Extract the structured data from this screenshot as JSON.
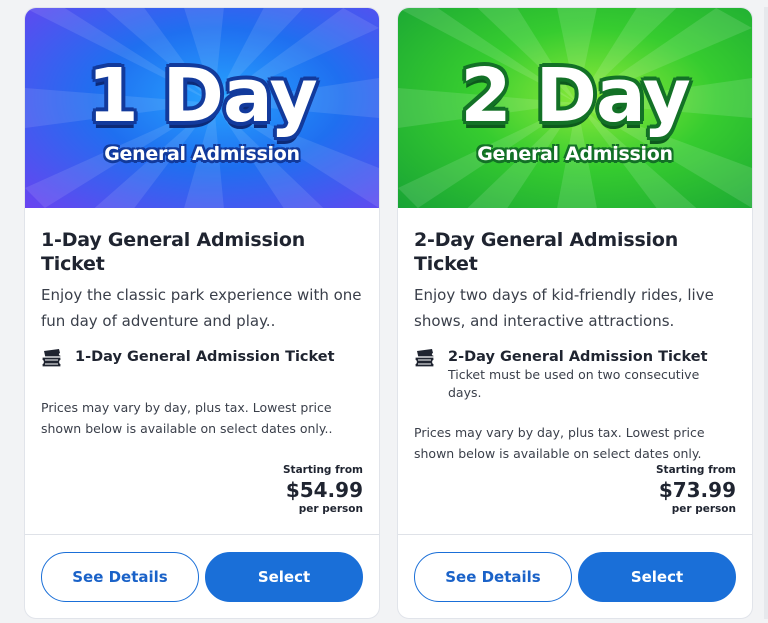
{
  "cards": [
    {
      "hero_title": "1 Day",
      "hero_subtitle": "General Admission",
      "title": "1-Day General Admission Ticket",
      "description": "Enjoy the classic park experience with one fun day of adventure and play..",
      "ticket_name": "1-Day General Admission Ticket",
      "ticket_note": "",
      "prices_note": "Prices may vary by day, plus tax. Lowest price shown below is available on select dates only..",
      "starting_label": "Starting from",
      "price": "$54.99",
      "per_label": "per person",
      "details_label": "See Details",
      "select_label": "Select",
      "ticket_icon": "ticket-icon"
    },
    {
      "hero_title": "2 Day",
      "hero_subtitle": "General Admission",
      "title": "2-Day General Admission Ticket",
      "description": "Enjoy two days of kid-friendly rides, live shows, and interactive attractions.",
      "ticket_name": "2-Day General Admission Ticket",
      "ticket_note": "Ticket must be used on two consecutive days.",
      "prices_note": "Prices may vary by day, plus tax. Lowest price shown below is available on select dates only.",
      "starting_label": "Starting from",
      "price": "$73.99",
      "per_label": "per person",
      "details_label": "See Details",
      "select_label": "Select",
      "ticket_icon": "ticket-icon"
    }
  ],
  "colors": {
    "primary": "#1a6fd8",
    "card1_hero": "#1f6ff0",
    "card2_hero": "#36cc2f",
    "text": "#1f2430"
  }
}
